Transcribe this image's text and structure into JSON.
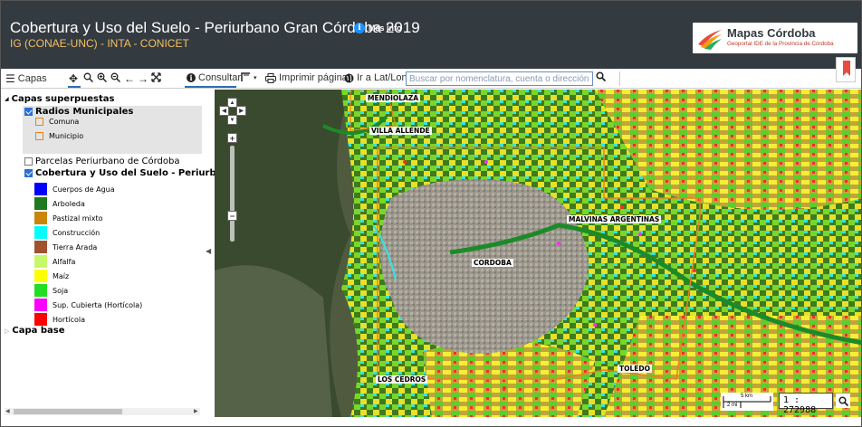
{
  "header": {
    "title": "Cobertura y Uso del Suelo - Periurbano Gran Córdoba 2019",
    "subtitle": "IG (CONAE-UNC) - INTA - CONICET",
    "info_label": "Más info",
    "logo": {
      "title": "Mapas Córdoba",
      "subtitle": "Geoportal IDE de la Provincia de Córdoba"
    }
  },
  "toolbar": {
    "layers_label": "Capas",
    "consultar_label": "Consultar",
    "print_label": "Imprimir página",
    "goto_label": "Ir a Lat/Lon",
    "search_placeholder": "Buscar por nomenclatura, cuenta o dirección"
  },
  "sidebar": {
    "overlay_group": "Capas superpuestas",
    "radios": {
      "label": "Radios Municipales",
      "checked": true,
      "legend": [
        {
          "label": "Comuna",
          "color": "#e8821e"
        },
        {
          "label": "Municipio",
          "color": "#e8821e"
        }
      ]
    },
    "parcelas": {
      "label": "Parcelas Periurbano de Córdoba",
      "checked": false
    },
    "cobertura": {
      "label": "Cobertura y Uso del Suelo - Periurbano d",
      "checked": true,
      "legend": [
        {
          "label": "Cuerpos de Agua",
          "color": "#0000ff"
        },
        {
          "label": "Arboleda",
          "color": "#1f7a1f"
        },
        {
          "label": "Pastizal mixto",
          "color": "#c8860a"
        },
        {
          "label": "Construcción",
          "color": "#00ffff"
        },
        {
          "label": "Tierra Arada",
          "color": "#a0522d"
        },
        {
          "label": "Alfalfa",
          "color": "#c7f76a"
        },
        {
          "label": "Maíz",
          "color": "#ffff00"
        },
        {
          "label": "Soja",
          "color": "#22dd22"
        },
        {
          "label": "Sup. Cubierta (Hortícola)",
          "color": "#ff00ff"
        },
        {
          "label": "Hortícola",
          "color": "#ff0000"
        }
      ]
    },
    "base_group": "Capa base"
  },
  "map": {
    "places": {
      "mendiolaza": "MENDIOLAZA",
      "villa_allende": "VILLA ALLENDE",
      "malvinas": "MALVINAS ARGENTINAS",
      "cordoba": "CORDOBA",
      "los_cedros": "LOS CEDROS",
      "toledo": "TOLEDO"
    },
    "scale": {
      "km_label": "5 km",
      "mi_label": "2 mi",
      "ratio": "1 : 272988"
    }
  }
}
